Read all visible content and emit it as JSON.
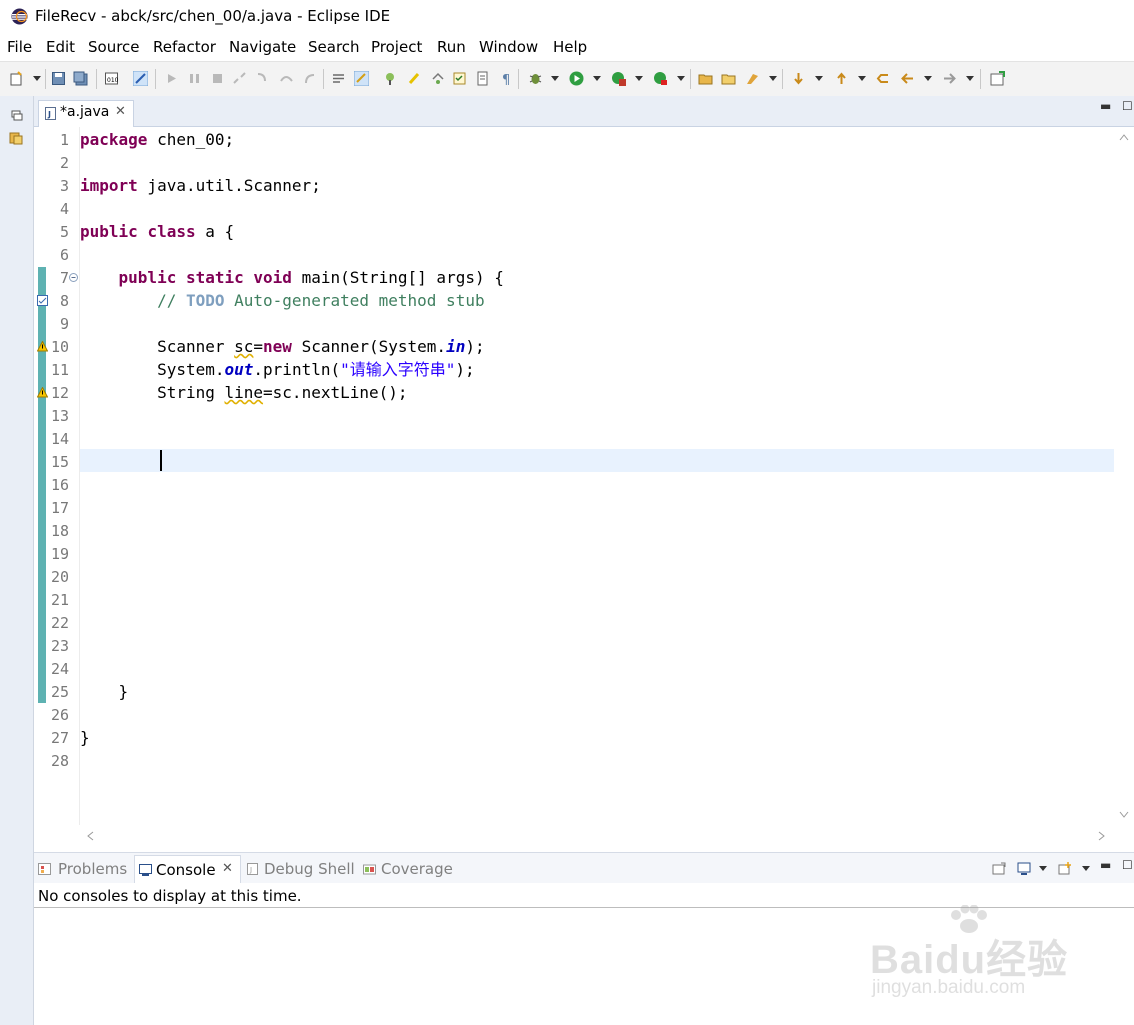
{
  "window": {
    "title": "FileRecv - abck/src/chen_00/a.java - Eclipse IDE"
  },
  "menu": [
    "File",
    "Edit",
    "Source",
    "Refactor",
    "Navigate",
    "Search",
    "Project",
    "Run",
    "Window",
    "Help"
  ],
  "editor": {
    "tab_label": "*a.java",
    "line_numbers": [
      "1",
      "2",
      "3",
      "4",
      "5",
      "6",
      "7",
      "8",
      "9",
      "10",
      "11",
      "12",
      "13",
      "14",
      "15",
      "16",
      "17",
      "18",
      "19",
      "20",
      "21",
      "22",
      "23",
      "24",
      "25",
      "26",
      "27",
      "28"
    ],
    "current_line": 15,
    "code": {
      "l1_kw": "package",
      "l1_rest": " chen_00;",
      "l3_kw": "import",
      "l3_rest": " java.util.Scanner;",
      "l5_kw1": "public",
      "l5_kw2": "class",
      "l5_rest": " a {",
      "l7_indent": "    ",
      "l7_kw1": "public",
      "l7_kw2": "static",
      "l7_kw3": "void",
      "l7_rest": " main(String[] args) {",
      "l8_indent": "        ",
      "l8_cm1": "// ",
      "l8_todo": "TODO",
      "l8_cm2": " Auto-generated method stub",
      "l10_indent": "        ",
      "l10_a": "Scanner ",
      "l10_var": "sc",
      "l10_b": "=",
      "l10_kw": "new",
      "l10_c": " Scanner(System.",
      "l10_fld": "in",
      "l10_d": ");",
      "l11_indent": "        ",
      "l11_a": "System.",
      "l11_fld": "out",
      "l11_b": ".println(",
      "l11_str": "\"请输入字符串\"",
      "l11_c": ");",
      "l12_indent": "        ",
      "l12_a": "String ",
      "l12_var": "line",
      "l12_b": "=sc.nextLine();",
      "l25": "    }",
      "l27": "}"
    }
  },
  "bottom_panel": {
    "tabs": [
      "Problems",
      "Console",
      "Debug Shell",
      "Coverage"
    ],
    "active_tab": "Console",
    "console_message": "No consoles to display at this time."
  },
  "watermark": {
    "main": "Baidu经验",
    "sub": "jingyan.baidu.com"
  }
}
